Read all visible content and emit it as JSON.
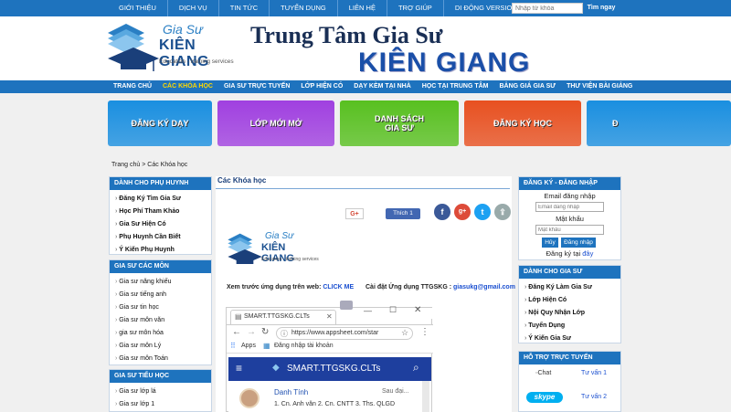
{
  "topbar": {
    "menu": [
      "GIỚI THIỆU",
      "DỊCH VỤ",
      "TIN TỨC",
      "TUYỂN DỤNG",
      "LIÊN HỆ",
      "TRỢ GIÚP",
      "DI ĐỘNG VERSION"
    ],
    "search_placeholder": "Nhập từ khóa",
    "search_button": "Tìm ngay"
  },
  "header": {
    "logo_line1": "Gia Sư",
    "logo_line2": "KIÊN GIANG",
    "logo_line3": "Education - training services",
    "title_line1": "Trung Tâm Gia Sư",
    "title_line2": "KIÊN GIANG"
  },
  "nav": {
    "items": [
      "TRANG CHỦ",
      "CÁC KHÓA HỌC",
      "GIA SƯ TRỰC TUYẾN",
      "LỚP HIỆN CÓ",
      "DẠY KÈM TẠI NHÀ",
      "HỌC TẠI TRUNG TÂM",
      "BẢNG GIÁ GIA SƯ",
      "THƯ VIỆN BÀI GIẢNG"
    ],
    "active_index": 1
  },
  "banners": [
    {
      "label": "ĐĂNG KÝ DẠY",
      "color": "#1a8fe0"
    },
    {
      "label": "LỚP MỚI MỞ",
      "color": "#a040e0"
    },
    {
      "label": "DANH SÁCH\nGIA SƯ",
      "color": "#58c020"
    },
    {
      "label": "ĐĂNG KÝ HỌC",
      "color": "#e85020"
    },
    {
      "label": "Đ",
      "color": "#1a8fe0"
    }
  ],
  "breadcrumb": {
    "home": "Trang chủ",
    "sep": ">",
    "current": "Các Khóa học"
  },
  "left": {
    "parents": {
      "title": "DÀNH CHO PHỤ HUYNH",
      "items": [
        "Đăng Ký Tìm Gia Sư",
        "Học Phí Tham Khảo",
        "Gia Sư Hiện Có",
        "Phụ Huynh Cần Biết",
        "Ý Kiến Phụ Huynh"
      ]
    },
    "subjects": {
      "title": "GIA SƯ CÁC MÔN",
      "items": [
        "Gia sư năng khiếu",
        "Gia sư tiếng anh",
        "Gia sư tin học",
        "Gia sư môn văn",
        "gia sư môn hóa",
        "Gia sư môn Lý",
        "Gia sư môn Toán"
      ]
    },
    "primary": {
      "title": "GIA SƯ TIỂU HỌC",
      "items": [
        "Gia sư lớp lá",
        "Gia sư lớp 1"
      ]
    }
  },
  "main": {
    "heading": "Các Khóa học",
    "gplus_label": "G+",
    "like_label": "Thích 1",
    "app_text": "Xem trước ứng dụng trên  web: ",
    "app_link": "CLICK ME",
    "install_text": "Cài đặt Ứng dụng TTGSKG : ",
    "install_email": "giasukg@gmail.com",
    "browser": {
      "tab_title": "SMART.TTGSKG.CLTs",
      "url": "https://www.appsheet.com/star",
      "apps_label": "Apps",
      "bookmark": "Đăng nhập tài khoản",
      "app_title": "SMART.TTGSKG.CLTs",
      "item_name": "Danh Tính",
      "item_time": "Sau đại...",
      "item_desc": "1. Cn. Anh văn 2. Cn. CNTT 3. Ths. QLGD"
    }
  },
  "right": {
    "login": {
      "title": "ĐĂNG KÝ - ĐĂNG NHẬP",
      "email_label": "Email đăng nhập",
      "email_placeholder": "Email đăng nhập",
      "password_label": "Mật khẩu",
      "password_placeholder": "Mật khẩu",
      "cancel": "Hủy",
      "login": "Đăng nhập",
      "register_text": "Đăng ký tại ",
      "register_link": "đây"
    },
    "tutors": {
      "title": "DÀNH CHO GIA SƯ",
      "items": [
        "Đăng Ký Làm Gia Sư",
        "Lớp Hiện Có",
        "Nội Quy Nhận Lớp",
        "Tuyển Dụng",
        "Ý Kiến Gia Sư"
      ]
    },
    "support": {
      "title": "HỖ TRỢ TRỰC TUYẾN",
      "chat_label": "Chat",
      "skype_label": "skype",
      "advisor1": "Tư vấn 1",
      "advisor2": "Tư vấn 2"
    }
  }
}
